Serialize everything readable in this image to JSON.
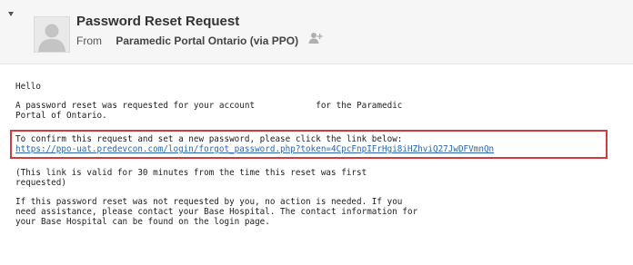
{
  "header": {
    "subject": "Password Reset Request",
    "from_label": "From",
    "sender": "Paramedic Portal Ontario (via PPO)",
    "icons": {
      "toggle": "collapse-triangle-icon",
      "avatar": "person-avatar-icon",
      "add_contact": "add-contact-icon"
    }
  },
  "body": {
    "greeting": "Hello",
    "intro": "A password reset was requested for your account            for the Paramedic\nPortal of Ontario.",
    "confirm_text": "To confirm this request and set a new password, please click the link below:",
    "reset_link": "https://ppo-uat.predevcon.com/login/forgot_password.php?token=4CpcFnpIFrHgi8iHZhviQ27JwDFVmnQn",
    "validity": "(This link is valid for 30 minutes from the time this reset was first\nrequested)",
    "not_requested": "If this password reset was not requested by you, no action is needed. If you\nneed assistance, please contact your Base Hospital. The contact information for\nyour Base Hospital can be found on the login page."
  },
  "colors": {
    "highlight_border": "#d03b3b",
    "link": "#2a66b0",
    "header_bg": "#f6f6f6"
  }
}
